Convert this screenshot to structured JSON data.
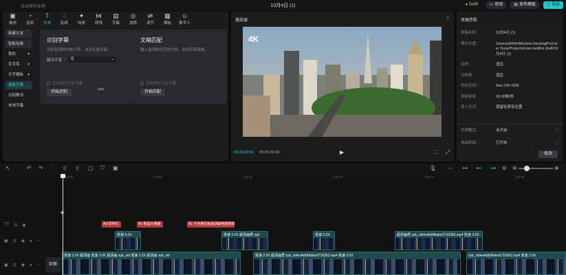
{
  "titlebar": {
    "saved_text": "自动保存本地",
    "title": "10月4日 (1)",
    "svip": "SVIP",
    "review": "审阅",
    "publish": "发布模板",
    "export": "导出"
  },
  "toolbar": [
    {
      "label": "素材",
      "icon": "▣",
      "name": "media"
    },
    {
      "label": "音频",
      "icon": "◔",
      "name": "audio"
    },
    {
      "label": "文本",
      "icon": "T",
      "name": "text"
    },
    {
      "label": "贴纸",
      "icon": "◌",
      "name": "sticker"
    },
    {
      "label": "特效",
      "icon": "✦",
      "name": "effects"
    },
    {
      "label": "转场",
      "icon": "⋈",
      "name": "transition"
    },
    {
      "label": "字幕",
      "icon": "▤",
      "name": "subtitle"
    },
    {
      "label": "滤镜",
      "icon": "◎",
      "name": "filter"
    },
    {
      "label": "调节",
      "icon": "⇌",
      "name": "adjust"
    },
    {
      "label": "模板",
      "icon": "▦",
      "name": "template"
    },
    {
      "label": "数字人",
      "icon": "☺",
      "name": "avatar"
    }
  ],
  "sidenav": [
    {
      "label": "新建文本",
      "type": "btn",
      "caret": ""
    },
    {
      "label": "智能包装",
      "type": "btn",
      "caret": ""
    },
    {
      "label": "我的",
      "type": "plain",
      "caret": "▾"
    },
    {
      "label": "花字库",
      "type": "plain",
      "caret": "▾"
    },
    {
      "label": "文字模板",
      "type": "plain",
      "caret": "▾"
    },
    {
      "label": "智能字幕",
      "type": "active",
      "caret": ""
    },
    {
      "label": "识别歌词",
      "type": "plain",
      "caret": ""
    },
    {
      "label": "本地字幕",
      "type": "plain",
      "caret": ""
    }
  ],
  "cards": {
    "recognize": {
      "title": "识别字幕",
      "desc": "识别音视频中的人声，自动生成字幕。",
      "lang_label": "翻译字幕",
      "lang_value": "无",
      "checkbox": "同时清空已有字幕",
      "button": "开始识别",
      "badge": "SVIP"
    },
    "match": {
      "title": "文稿匹配",
      "desc": "输入音视频对应的文稿，自动匹配画面。",
      "checkbox": "同时清空已有字幕",
      "button": "开始匹配"
    }
  },
  "player": {
    "title": "播放器",
    "current_time": "00:00:00:02",
    "total_time": "00:00:29:09"
  },
  "info": {
    "title": "草稿参数",
    "rows": [
      {
        "k": "草稿名称：",
        "v": "10月4日 (1)"
      },
      {
        "k": "保存位置：",
        "v": "/Users/yhhhh/Movies/JianyingPro/User Data/Projects/com.lveditor.draft/10月4日 (1)"
      },
      {
        "k": "比例：",
        "v": "适应"
      },
      {
        "k": "分辨率：",
        "v": "适应"
      },
      {
        "k": "色彩空间：",
        "v": "Rec.709 SDR"
      },
      {
        "k": "草稿帧率：",
        "v": "30.00帧/秒"
      },
      {
        "k": "导入方式：",
        "v": "保留在原有位置"
      }
    ],
    "rows2": [
      {
        "k": "代理模式：",
        "v": "未开启"
      },
      {
        "k": "自由层级：",
        "v": "已开启"
      }
    ],
    "modify": "修改"
  },
  "ruler": [
    "00:00",
    "| 00:05",
    "| 00:10",
    "| 00:15",
    "| 00:20",
    "| 00:25"
  ],
  "text_clips": [
    {
      "label": "A3 同学们"
    },
    {
      "label": "A1 我是大英雄"
    },
    {
      "label": "A1 今天我们就来讲解电影特效"
    }
  ],
  "clips_track2": [
    {
      "label": "变速 2.0X"
    },
    {
      "label": "变速 2.0X   超清画质   syb"
    },
    {
      "label": "变速 2.0X"
    },
    {
      "label": "超清画质   syb_videoAddWater6716362.mp4   变速 2.0X"
    }
  ],
  "clips_main": [
    {
      "label": "变速 2.0X   超清画   变速 2.0X   超清画   syb_vid   变速 2.0X   超清画   syb_vid"
    },
    {
      "label": "变速 2.0X   超清画质   syb_videoAddWater6716362.mp4   变速 2.0X"
    },
    {
      "label": "syb_videoAddWater6716362.mp4   变速 2.0X"
    }
  ],
  "cover": "封面"
}
